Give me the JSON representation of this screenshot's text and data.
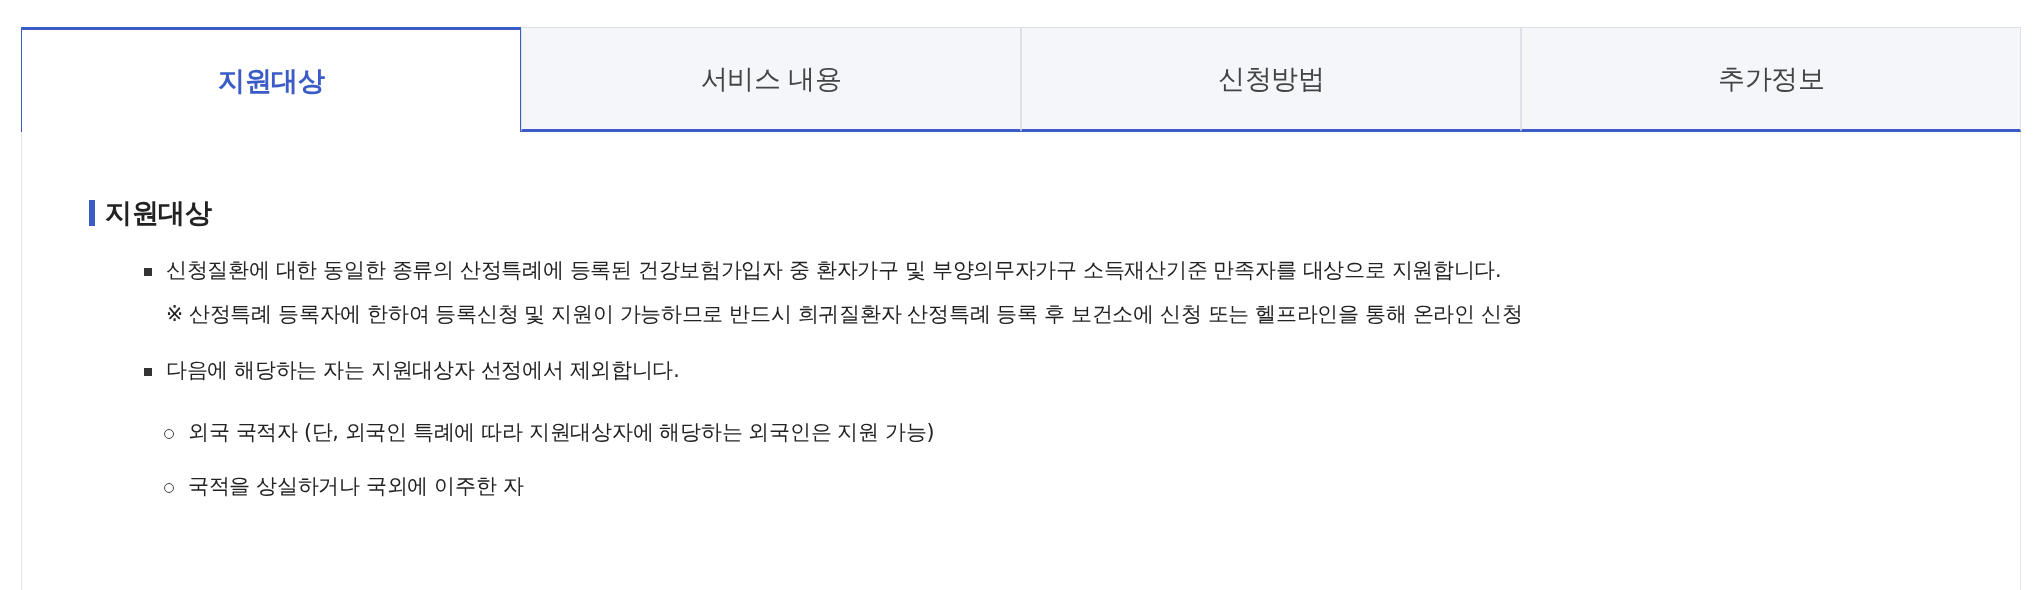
{
  "tabs": [
    {
      "label": "지원대상",
      "selected": true
    },
    {
      "label": "서비스 내용",
      "selected": false
    },
    {
      "label": "신청방법",
      "selected": false
    },
    {
      "label": "추가정보",
      "selected": false
    }
  ],
  "section": {
    "title": "지원대상",
    "items": [
      {
        "text": "신청질환에 대한 동일한 종류의 산정특례에 등록된 건강보험가입자 중 환자가구 및 부양의무자가구 소득재산기준 만족자를 대상으로 지원합니다.",
        "note": "※ 산정특례 등록자에 한하여 등록신청 및 지원이 가능하므로 반드시 희귀질환자 산정특례 등록 후 보건소에 신청 또는 헬프라인을 통해 온라인 신청"
      },
      {
        "text": "다음에 해당하는 자는 지원대상자 선정에서 제외합니다.",
        "children": [
          {
            "text": "외국 국적자 (단, 외국인 특례에 따라 지원대상자에 해당하는 외국인은 지원 가능)"
          },
          {
            "text": "국적을 상실하거나 국외에 이주한 자"
          }
        ]
      }
    ]
  }
}
